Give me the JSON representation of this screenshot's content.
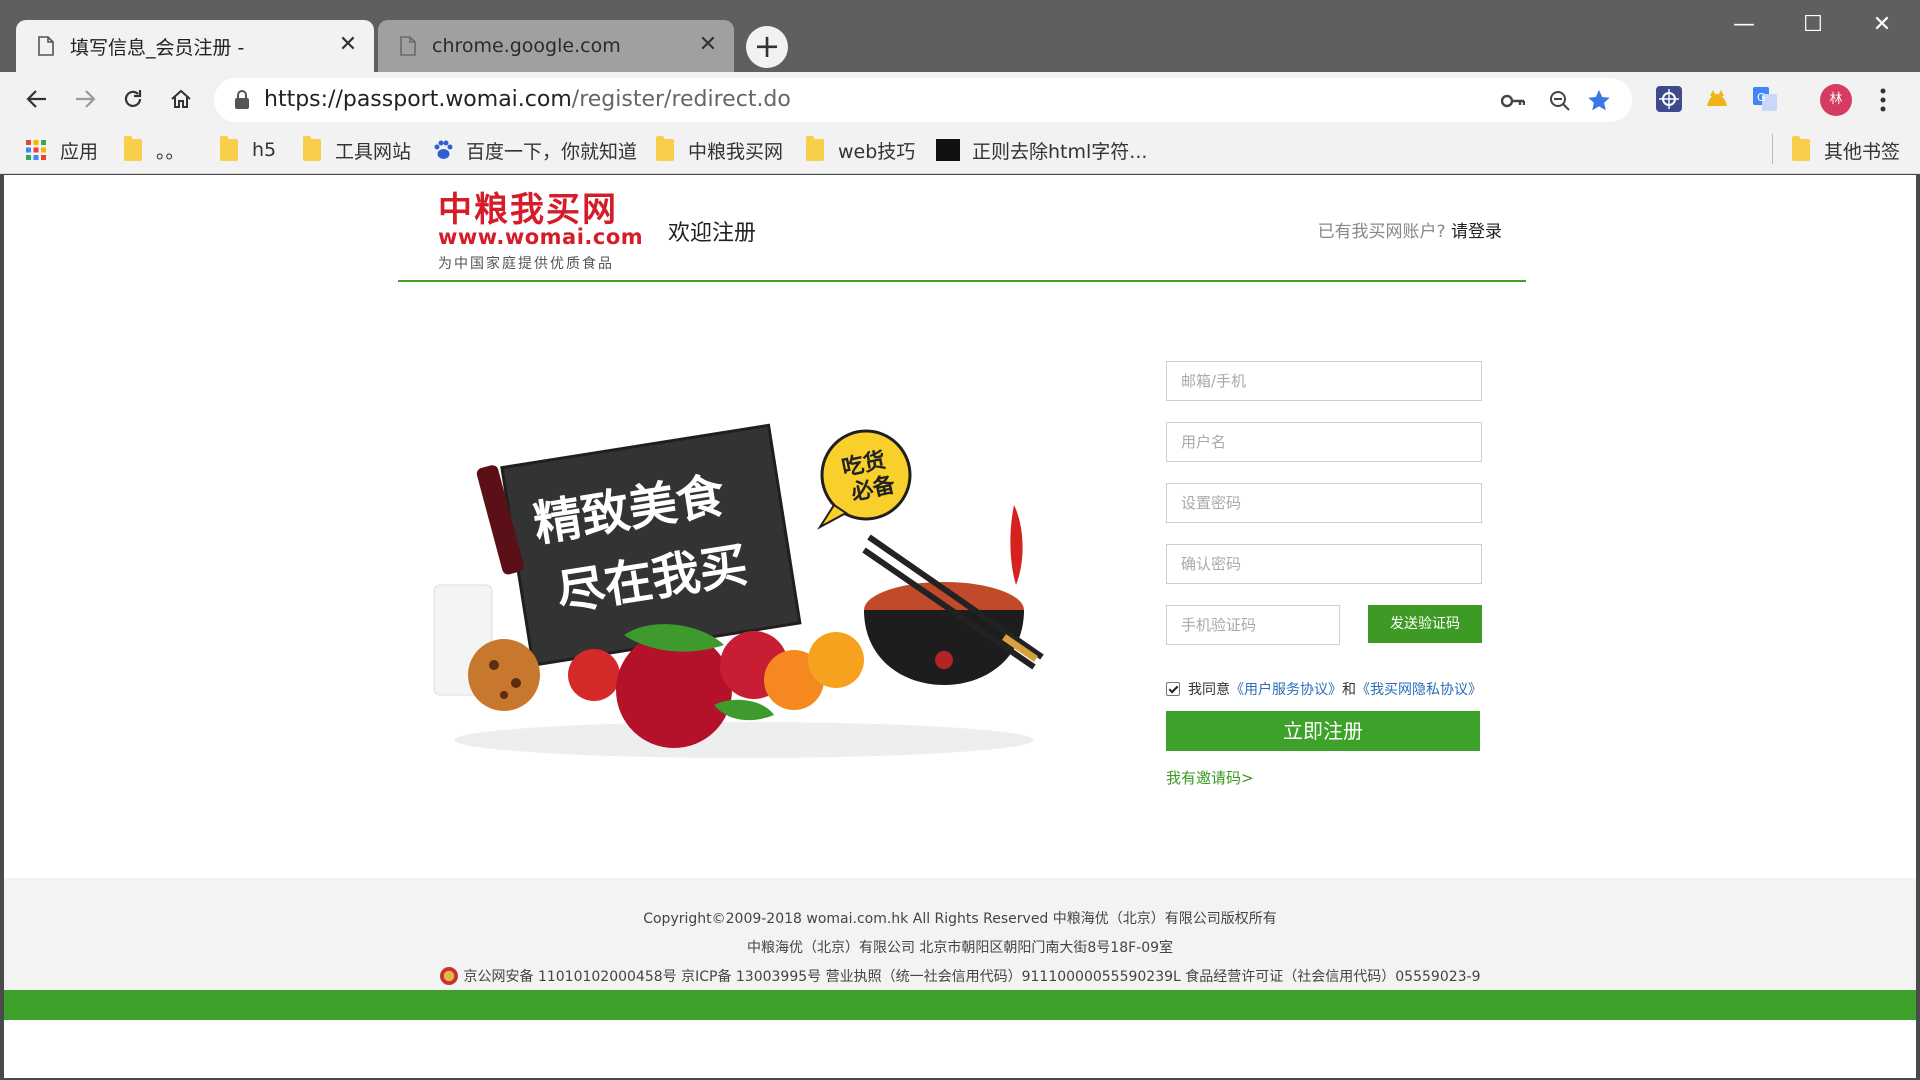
{
  "browser": {
    "tabs": [
      {
        "title": "填写信息_会员注册 -",
        "close": "✕"
      },
      {
        "title": "chrome.google.com",
        "close": "✕"
      }
    ],
    "new_tab": "+",
    "window": {
      "minimize": "—",
      "maximize": "☐",
      "close": "✕"
    },
    "url": {
      "host": "https://passport.womai.com",
      "path": "/register/redirect.do"
    },
    "profile_initial": "林"
  },
  "bookmarks": [
    {
      "label": "应用",
      "icon": "apps-grid-icon"
    },
    {
      "label": "。。",
      "icon": "folder-icon"
    },
    {
      "label": "h5",
      "icon": "folder-icon"
    },
    {
      "label": "工具网站",
      "icon": "folder-icon"
    },
    {
      "label": "百度一下，你就知道",
      "icon": "baidu-icon"
    },
    {
      "label": "中粮我买网",
      "icon": "folder-icon"
    },
    {
      "label": "web技巧",
      "icon": "folder-icon"
    },
    {
      "label": "正则去除html字符...",
      "icon": "site-icon"
    },
    {
      "label": "其他书签",
      "icon": "folder-icon"
    }
  ],
  "header": {
    "logo_cn": "中粮我买网",
    "logo_en": "www.womai.com",
    "logo_slogan": "为中国家庭提供优质食品",
    "welcome": "欢迎注册",
    "login_prompt": "已有我买网账户?",
    "login_link": "请登录"
  },
  "promo": {
    "line1": "精致美食",
    "line2": "尽在我买",
    "badge1": "吃货",
    "badge2": "必备"
  },
  "form": {
    "account_placeholder": "邮箱/手机",
    "username_placeholder": "用户名",
    "password_placeholder": "设置密码",
    "confirm_placeholder": "确认密码",
    "sms_placeholder": "手机验证码",
    "send_code": "发送验证码",
    "agree_prefix": "我同意",
    "agree_link1": "《用户服务协议》",
    "agree_and": "和",
    "agree_link2": "《我买网隐私协议》",
    "agree_checked": true,
    "register": "立即注册",
    "invite": "我有邀请码>"
  },
  "footer": {
    "line1": "Copyright©2009-2018 womai.com.hk All Rights Reserved 中粮海优（北京）有限公司版权所有",
    "line2": "中粮海优（北京）有限公司 北京市朝阳区朝阳门南大街8号18F-09室",
    "line3": "京公网安备 11010102000458号  京ICP备 13003995号 营业执照（统一社会信用代码）91110000055590239L 食品经营许可证（社会信用代码）05559023-9"
  },
  "colors": {
    "brand_green": "#3da229",
    "brand_red": "#d51d2a",
    "link_blue": "#2a6fb6"
  }
}
